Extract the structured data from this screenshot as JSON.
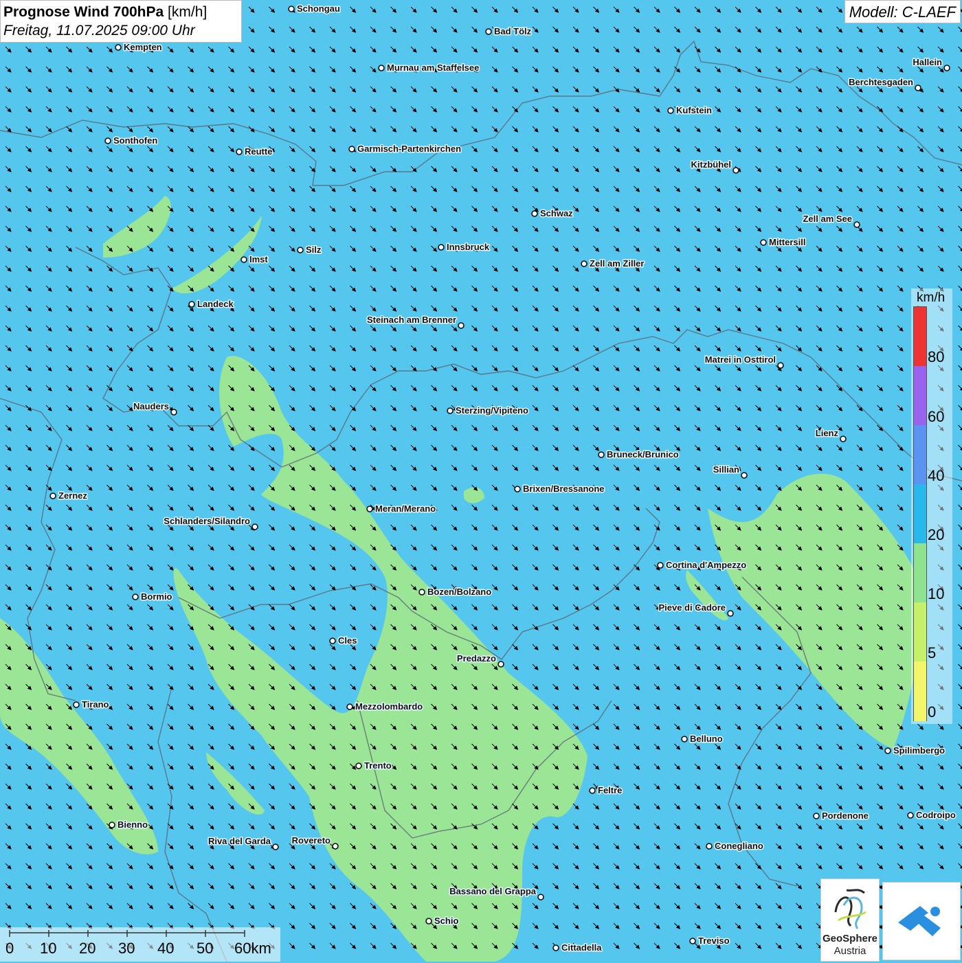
{
  "title": {
    "main": "Prognose Wind 700hPa",
    "unit": "[km/h]",
    "datetime": "Freitag, 11.07.2025 09:00 Uhr"
  },
  "model": "Modell: C-LAEF",
  "legend": {
    "unit": "km/h",
    "ticks": [
      "80",
      "60",
      "40",
      "20",
      "10",
      "5",
      "0"
    ],
    "bands": [
      {
        "color": "#ee3333"
      },
      {
        "color": "#9a63ee"
      },
      {
        "color": "#5b94f0"
      },
      {
        "color": "#29b8ea"
      },
      {
        "color": "#8ee38f"
      },
      {
        "color": "#c7f06a"
      },
      {
        "color": "#f3f56a"
      }
    ]
  },
  "scalebar": {
    "ticks": [
      "0",
      "10",
      "20",
      "30",
      "40",
      "50",
      "60km"
    ]
  },
  "logos": {
    "geosphere_line1": "GeoSphere",
    "geosphere_line2": "Austria"
  },
  "wind_field": {
    "dominant_direction": "northwest-to-southeast",
    "base_color": "#55c6ee",
    "calm_zone_color": "#9be596",
    "arrow_color": "#000000"
  },
  "cities": [
    {
      "name": "Schongau"
    },
    {
      "name": "Bad Tölz"
    },
    {
      "name": "Kempten"
    },
    {
      "name": "Murnau am Staffelsee"
    },
    {
      "name": "Hallein"
    },
    {
      "name": "Berchtesgaden"
    },
    {
      "name": "Kufstein"
    },
    {
      "name": "Sonthofen"
    },
    {
      "name": "Reutte"
    },
    {
      "name": "Garmisch-Partenkirchen"
    },
    {
      "name": "Kitzbühel"
    },
    {
      "name": "Schwaz"
    },
    {
      "name": "Zell am See"
    },
    {
      "name": "Mittersill"
    },
    {
      "name": "Silz"
    },
    {
      "name": "Innsbruck"
    },
    {
      "name": "Imst"
    },
    {
      "name": "Zell am Ziller"
    },
    {
      "name": "Landeck"
    },
    {
      "name": "Steinach am Brenner"
    },
    {
      "name": "Matrei in Osttirol"
    },
    {
      "name": "Nauders"
    },
    {
      "name": "Sterzing/Vipiteno"
    },
    {
      "name": "Lienz"
    },
    {
      "name": "Bruneck/Brunico"
    },
    {
      "name": "Sillian"
    },
    {
      "name": "Brixen/Bressanone"
    },
    {
      "name": "Zernez"
    },
    {
      "name": "Meran/Merano"
    },
    {
      "name": "Schlanders/Silandro"
    },
    {
      "name": "Cortina d'Ampezzo"
    },
    {
      "name": "Bozen/Bolzano"
    },
    {
      "name": "Bormio"
    },
    {
      "name": "Pieve di Cadore"
    },
    {
      "name": "Cles"
    },
    {
      "name": "Predazzo"
    },
    {
      "name": "Tirano"
    },
    {
      "name": "Mezzolombardo"
    },
    {
      "name": "Belluno"
    },
    {
      "name": "Spilimbergo"
    },
    {
      "name": "Trento"
    },
    {
      "name": "Feltre"
    },
    {
      "name": "Pordenone"
    },
    {
      "name": "Codroipo"
    },
    {
      "name": "Bienno"
    },
    {
      "name": "Riva del Garda"
    },
    {
      "name": "Rovereto"
    },
    {
      "name": "Conegliano"
    },
    {
      "name": "Bassano del Grappa"
    },
    {
      "name": "Schio"
    },
    {
      "name": "Treviso"
    },
    {
      "name": "Cittadella"
    }
  ]
}
